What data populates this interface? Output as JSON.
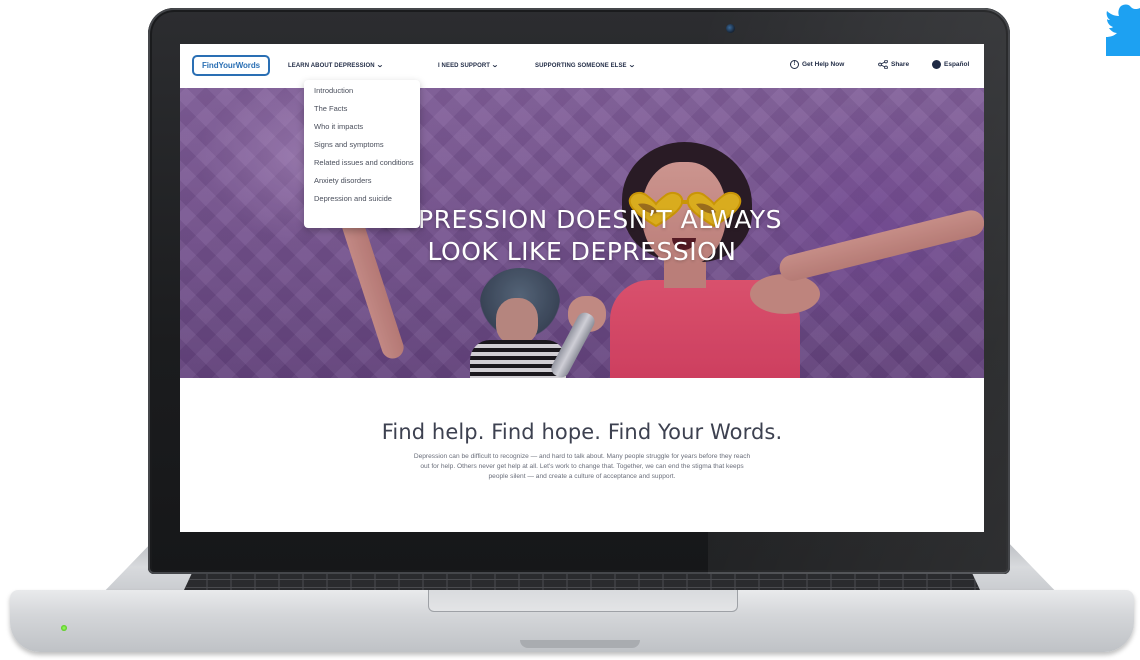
{
  "site": {
    "logo_text": "FindYourWords"
  },
  "nav": {
    "items": [
      {
        "label": "LEARN ABOUT DEPRESSION",
        "icon": "chevron-down-icon"
      },
      {
        "label": "I NEED SUPPORT",
        "icon": "chevron-down-icon"
      },
      {
        "label": "SUPPORTING SOMEONE ELSE",
        "icon": "chevron-down-icon"
      }
    ],
    "right": [
      {
        "label": "Get Help Now",
        "icon": "info-circle-icon"
      },
      {
        "label": "Share",
        "icon": "share-icon"
      },
      {
        "label": "Español",
        "icon": "globe-icon"
      }
    ]
  },
  "dropdown": {
    "items": [
      "Introduction",
      "The Facts",
      "Who it impacts",
      "Signs and symptoms",
      "Related issues and conditions",
      "Anxiety disorders",
      "Depression and suicide"
    ]
  },
  "hero": {
    "title_line1": "DEPRESSION DOESN’T ALWAYS",
    "title_line2": "LOOK LIKE DEPRESSION"
  },
  "content": {
    "tagline": "Find help. Find hope. Find Your Words.",
    "paragraph": "Depression can be difficult to recognize — and hard to talk about. Many people struggle for years before they reach out for help. Others never get help at all. Let's work to change that. Together, we can end the stigma that keeps people silent — and create a culture of acceptance and support."
  },
  "colors": {
    "brand_blue": "#2a6fb4",
    "nav_text": "#1f2a44",
    "hero_purple": "#7e5a99",
    "twitter_blue": "#1da1f2"
  },
  "decor": {
    "corner_logo_icon": "twitter-bird-icon"
  }
}
